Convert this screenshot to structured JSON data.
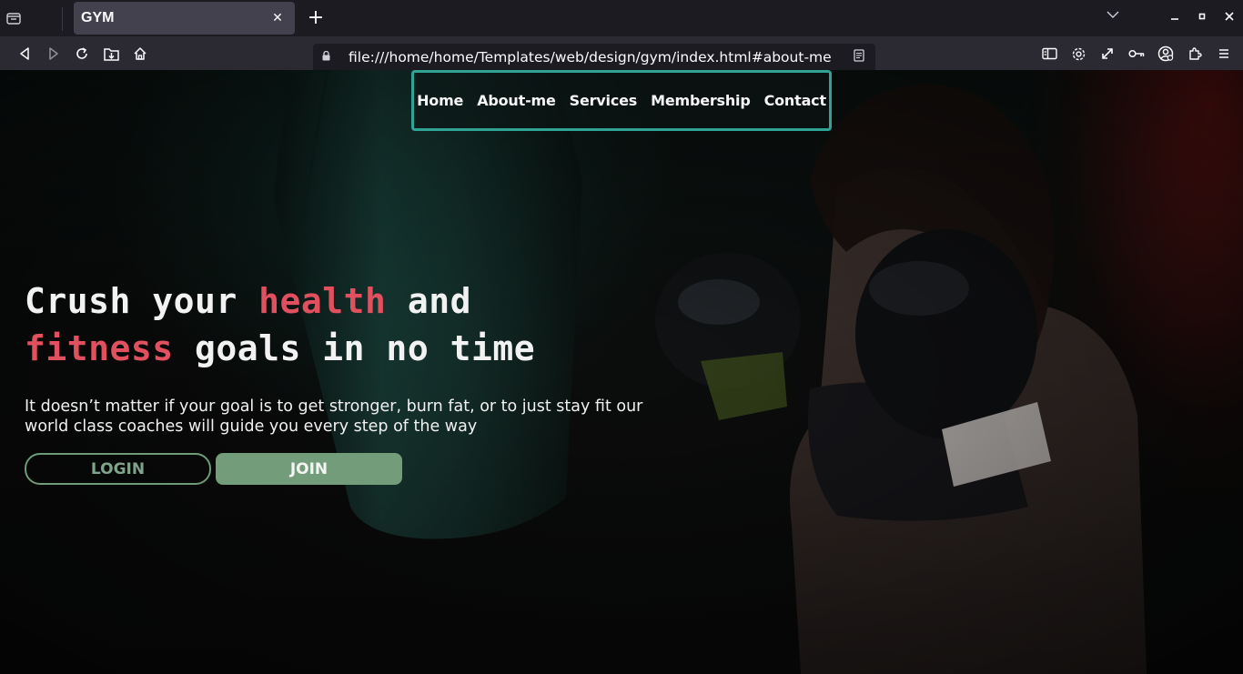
{
  "browser": {
    "tab_title": "GYM",
    "tab_close": "✕",
    "new_tab": "+",
    "url": "file:///home/home/Templates/web/design/gym/index.html#about-me",
    "icons": [
      "tab-list-icon",
      "back-icon",
      "forward-icon",
      "reload-icon",
      "save-page-icon",
      "home-icon",
      "lock-icon",
      "reader-view-icon",
      "sidebar-icon",
      "settings-icon",
      "fullscreen-icon",
      "passwords-icon",
      "account-icon",
      "extensions-icon",
      "menu-icon"
    ]
  },
  "site": {
    "nav": [
      "Home",
      "About-me",
      "Services",
      "Membership",
      "Contact"
    ],
    "hero": {
      "title_parts": [
        "Crush your ",
        "health",
        " and",
        "fitness",
        " goals in no time"
      ],
      "subtitle": "It doesn’t matter if your goal is to get stronger, burn fat, or to just stay fit our world class coaches will guide you every step of the way",
      "login_label": "LOGIN",
      "join_label": "JOIN"
    }
  },
  "colors": {
    "nav_border": "#2fa394",
    "accent": "#e0505e",
    "button_green": "#729c7a"
  }
}
